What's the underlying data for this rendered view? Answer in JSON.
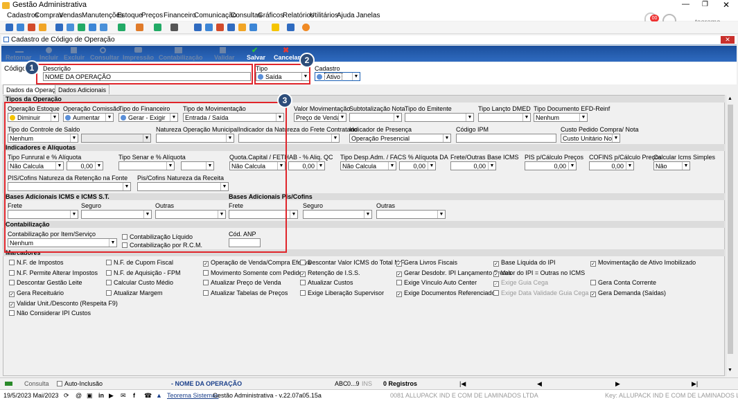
{
  "app_title": "Gestão Administrativa",
  "menu": [
    "Cadastros",
    "Compras",
    "Vendas",
    "Manutenções",
    "Estoque",
    "Preços",
    "Financeiro",
    "Comunicação",
    "Consultas",
    "Gráficos",
    "Relatórios",
    "Utilitários",
    "Ajuda",
    "Janelas"
  ],
  "notification_count": "00",
  "user_name": "teorema",
  "window_title": "Cadastro de Código de Operação",
  "ribbon": {
    "retornar": "Retornar",
    "incluir": "Incluir",
    "excluir": "Excluir",
    "consultar": "Consultar",
    "impressao": "Impressão",
    "contabilizacao": "Contabilização",
    "validar": "Validar",
    "salvar": "Salvar",
    "cancelar": "Cancelar"
  },
  "header": {
    "codigo_label": "Código",
    "descricao_label": "Descrição",
    "descricao_value": "NOME DA OPERAÇÃO",
    "tipo_label": "Tipo",
    "tipo_value": "Saída",
    "cadastro_label": "Cadastro",
    "cadastro_value": "Ativo"
  },
  "tabs": [
    "Dados da Operação",
    "Dados Adicionais"
  ],
  "badges": [
    "1",
    "2",
    "3"
  ],
  "sections": {
    "tipos": "Tipos da Operação",
    "indicadores": "Indicadores e Alíquotas",
    "bases": "Bases Adicionais ICMS e ICMS S.T.",
    "bases_pis": "Bases Adicionais Pis/Cofins",
    "contab": "Contabilização",
    "marcadores": "Marcadores"
  },
  "tipos_row1": {
    "op_estoque": {
      "label": "Operação Estoque",
      "value": "Diminuir"
    },
    "op_comissao": {
      "label": "Operação Comissão",
      "value": "Aumentar"
    },
    "tipo_fin": {
      "label": "Tipo do Financeiro",
      "value": "Gerar - Exigir"
    },
    "tipo_mov": {
      "label": "Tipo de Movimentação",
      "value": "Entrada / Saída"
    },
    "valor_mov": {
      "label": "Valor Movimentação",
      "value": "Preço de Venda"
    },
    "subtot": {
      "label": "Subtotalização Nota",
      "value": ""
    },
    "tipo_emit": {
      "label": "Tipo do Emitente",
      "value": ""
    },
    "tipo_dmed": {
      "label": "Tipo Lançto DMED",
      "value": ""
    },
    "tipo_efd": {
      "label": "Tipo Documento EFD-Reinf",
      "value": "Nenhum"
    }
  },
  "tipos_row2": {
    "ctrl_saldo": {
      "label": "Tipo do Controle de Saldo",
      "value": "Nenhum"
    },
    "natureza": {
      "label": "Natureza Operação Municipal",
      "value": ""
    },
    "ind_nat": {
      "label": "Indicador da Natureza do Frete Contratado",
      "value": ""
    },
    "ind_pres": {
      "label": "Indicador de Presença",
      "value": "Operação Presencial"
    },
    "cod_ipm": {
      "label": "Código IPM",
      "value": ""
    },
    "custo": {
      "label": "Custo Pedido Compra/ Nota",
      "value": "Custo Unitário Nota"
    }
  },
  "ind": {
    "funrural": {
      "label": "Tipo Funrural e % Alíquota",
      "value": "Não Calcula",
      "pct": "0,00"
    },
    "senar": {
      "label": "Tipo Senar e % Alíquota",
      "value": "",
      "pct": ""
    },
    "quota": {
      "label": "Quota.Capital / FETHAB - % Aliq. QC",
      "value": "Não Calcula",
      "pct": "0,00"
    },
    "desp": {
      "label": "Tipo Desp.Adm. / FACS % Alíquota DA",
      "value": "Não Calcula",
      "pct": "0,00"
    },
    "frete": {
      "label": "Frete/Outras Base ICMS",
      "pct": "0,00"
    },
    "pis": {
      "label": "PIS p/Cálculo Preços",
      "pct": "0,00"
    },
    "cofins": {
      "label": "COFINS p/Cálculo Preços",
      "pct": "0,00"
    },
    "icms_simples": {
      "label": "Calcular Icms Simples",
      "value": "Não"
    },
    "pis_ret": {
      "label": "PIS/Cofins Natureza da Retenção na Fonte",
      "value": ""
    },
    "pis_rec": {
      "label": "Pis/Cofins Natureza da Receita",
      "value": ""
    }
  },
  "bases_labels": {
    "frete": "Frete",
    "seguro": "Seguro",
    "outras": "Outras"
  },
  "contab": {
    "label": "Contabilização por Item/Serviço",
    "value": "Nenhum",
    "liquido": "Contabilização Líquido",
    "rcm": "Contabilização por R.C.M.",
    "anp_label": "Cód. ANP",
    "anp_value": ""
  },
  "marcadores": [
    [
      "N.F. de Impostos",
      "N.F. Permite Alterar Impostos",
      "Descontar Gestão Leite",
      "Gera Receituário",
      "Validar Unit./Desconto (Respeita F9)",
      "Não Considerar IPI Custos"
    ],
    [
      "N.F. de Cupom Fiscal",
      "N.F. de Aquisição - FPM",
      "Calcular Custo Médio",
      "Atualizar Margem"
    ],
    [
      "Operação de Venda/Compra Efetiva",
      "Movimento Somente com Pedido",
      "Atualizar Preço de Venda",
      "Atualizar Tabelas de Preços"
    ],
    [
      "Descontar Valor ICMS do Total N.F.",
      "Retenção de I.S.S.",
      "Atualizar Custos",
      "Exige Liberação Supervisor"
    ],
    [
      "Gera Livros Fiscais",
      "Gerar Desdobr. IPI Lançamento Fretes",
      "Exige Vínculo Auto Center",
      "Exige Documentos Referenciados"
    ],
    [
      "Base Líquida do IPI",
      "Valor do IPI = Outras no ICMS",
      "Exige Guia Cega",
      "Exige Data Validade Guia Cega"
    ],
    [
      "Movimentação de Ativo Imobilizado",
      "",
      "Gera Conta Corrente",
      "Gera Demanda (Saídas)"
    ]
  ],
  "status": {
    "consulta": "Consulta",
    "auto_inclusao": "Auto-Inclusão",
    "op_name": "- NOME DA OPERAÇÃO",
    "abc": "ABC",
    "range": "0...9",
    "ins": "INS",
    "registros": "0 Registros"
  },
  "bottom": {
    "date": "19/5/2023 Mai/2023",
    "company_link": "Teorema Sistemas",
    "version": "Gestão Administrativa - v.22.07a05.15a",
    "licensed": "0081 ALLUPACK IND E COM DE LAMINADOS LTDA",
    "key": "Key: ALLUPACK IND E COM DE LAMINADOS LTDA"
  }
}
